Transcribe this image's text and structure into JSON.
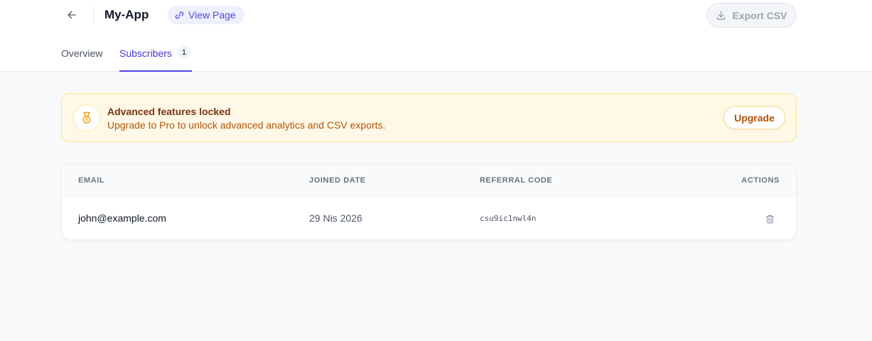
{
  "header": {
    "title": "My-App",
    "view_page_label": "View Page",
    "export_label": "Export CSV"
  },
  "tabs": [
    {
      "label": "Overview",
      "active": false
    },
    {
      "label": "Subscribers",
      "active": true,
      "count": "1"
    }
  ],
  "banner": {
    "icon": "medal-icon",
    "title": "Advanced features locked",
    "message": "Upgrade to Pro to unlock advanced analytics and CSV exports.",
    "button_label": "Upgrade"
  },
  "table": {
    "columns": [
      "EMAIL",
      "JOINED DATE",
      "REFERRAL CODE",
      "ACTIONS"
    ],
    "rows": [
      {
        "email": "john@example.com",
        "joined": "29 Nis 2026",
        "referral_code": "csu9ic1nwl4n",
        "action_icon": "trash-icon"
      }
    ]
  },
  "colors": {
    "accent": "#4f46e5",
    "banner_bg": "#fff8e6",
    "banner_border": "#fde68a",
    "warning_text": "#b45309"
  }
}
